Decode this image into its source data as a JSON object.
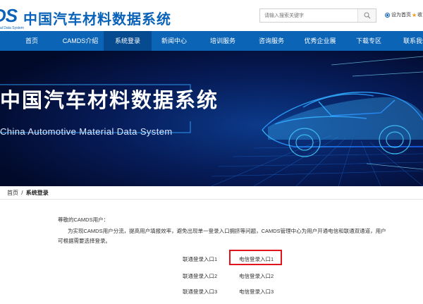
{
  "header": {
    "logo_mark": "DS",
    "logo_title": "中国汽车材料数据系统",
    "logo_subtitle": "al Data System",
    "search_placeholder": "请输入搜索关键字",
    "set_home": "设为首页",
    "favorite": "收"
  },
  "nav": {
    "items": [
      "首页",
      "CAMDS介绍",
      "系统登录",
      "新闻中心",
      "培训服务",
      "咨询服务",
      "优秀企业展",
      "下载专区",
      "联系我们"
    ],
    "active": "系统登录"
  },
  "banner": {
    "title": "中国汽车材料数据系统",
    "subtitle": "China Automotive Material Data System"
  },
  "breadcrumb": {
    "home": "首页",
    "separator": "/",
    "current": "系统登录"
  },
  "content": {
    "greeting": "尊敬的CAMDS用户：",
    "para1": "为实现CAMDS用户分流，提高用户填报效率，避免出现单一登录入口拥挤等问题，CAMDS管理中心为用户开通电信和联通双通道，用户",
    "para2": "可根据需要选择登录。"
  },
  "entries": {
    "unicom": [
      "联通登录入口1",
      "联通登录入口2",
      "联通登录入口3"
    ],
    "telecom": [
      "电信登录入口1",
      "电信登录入口2",
      "电信登录入口3"
    ]
  },
  "colors": {
    "brand_blue": "#0b64b6",
    "nav_active": "#064a8f",
    "highlight_red": "#e0141b",
    "banner_bg": "#020b2e"
  }
}
